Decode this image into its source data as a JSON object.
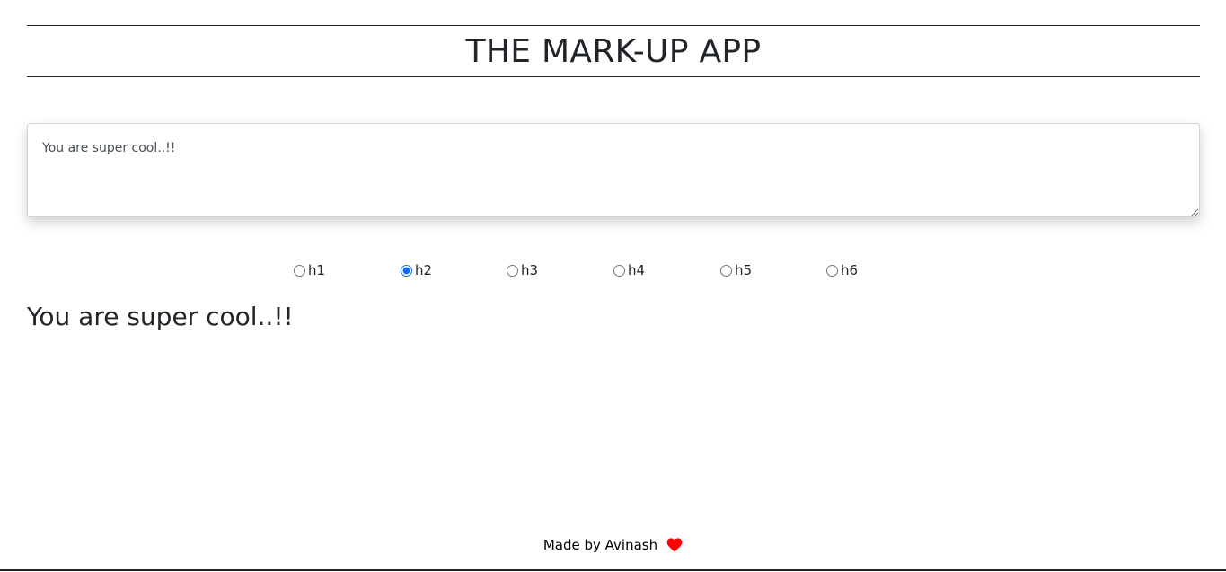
{
  "header": {
    "title": "THE MARK-UP APP"
  },
  "editor": {
    "value": "You are super cool..!!"
  },
  "heading_options": {
    "selected": "h2",
    "items": [
      {
        "label": "h1",
        "value": "h1"
      },
      {
        "label": "h2",
        "value": "h2"
      },
      {
        "label": "h3",
        "value": "h3"
      },
      {
        "label": "h4",
        "value": "h4"
      },
      {
        "label": "h5",
        "value": "h5"
      },
      {
        "label": "h6",
        "value": "h6"
      }
    ]
  },
  "preview": {
    "text": "You are super cool..!!"
  },
  "footer": {
    "text": "Made by Avinash",
    "icon": "heart-icon",
    "icon_color": "#ff0000"
  },
  "colors": {
    "radio_accent": "#0d6efd",
    "text": "#212529"
  }
}
